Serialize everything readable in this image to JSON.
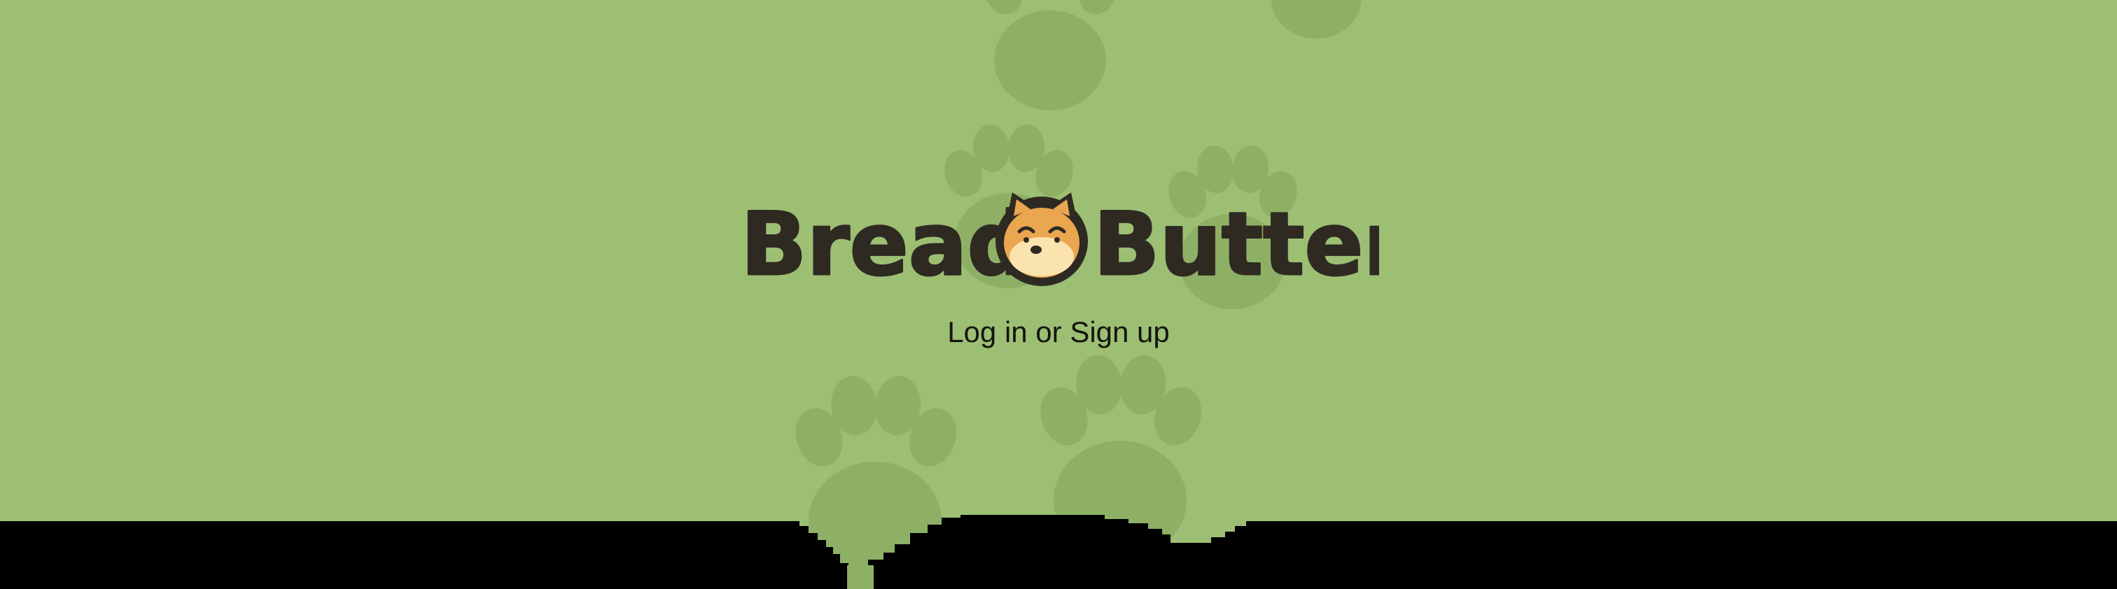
{
  "brand": {
    "word_left": "Bread",
    "word_right": "Butter",
    "logo_icon": "shiba-dog-face-icon"
  },
  "auth": {
    "link_label": "Log in or Sign up"
  },
  "decor": {
    "pattern_icon": "paw-print-icon"
  },
  "colors": {
    "background": "#9dbf74",
    "paw": "#8eb065",
    "text": "#2e2a22",
    "dog_orange": "#eba74f",
    "dog_cream": "#fbe3b0",
    "bottom_band": "#000000"
  }
}
